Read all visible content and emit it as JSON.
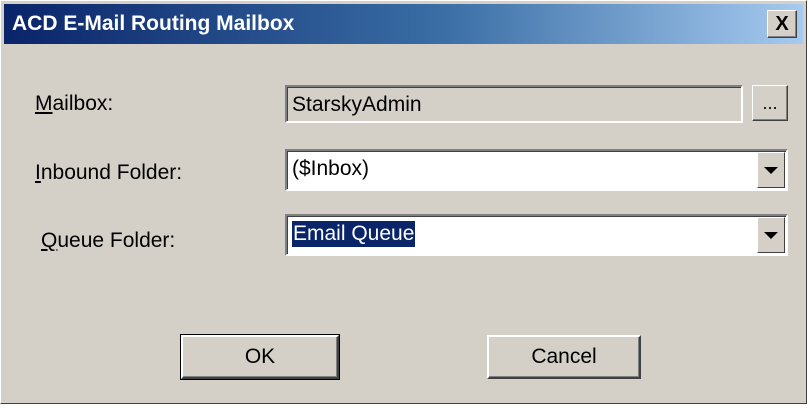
{
  "window": {
    "title": "ACD E-Mail Routing Mailbox",
    "close_glyph": "X"
  },
  "mailbox": {
    "label_hotkey": "M",
    "label_rest": "ailbox:",
    "value": "StarskyAdmin",
    "browse_label": "..."
  },
  "inbound_folder": {
    "label_hotkey": "I",
    "label_rest": "nbound Folder:",
    "value": "($Inbox)"
  },
  "queue_folder": {
    "label_hotkey": "Q",
    "label_rest": "ueue Folder:",
    "value": "Email Queue"
  },
  "buttons": {
    "ok_label": "OK",
    "cancel_label": "Cancel"
  },
  "icons": {
    "close": "close-icon",
    "dropdown": "chevron-down-icon"
  },
  "colors": {
    "title_start": "#0a246a",
    "title_end": "#a6caf0",
    "face": "#d4d0c8",
    "selection": "#0a246a"
  }
}
